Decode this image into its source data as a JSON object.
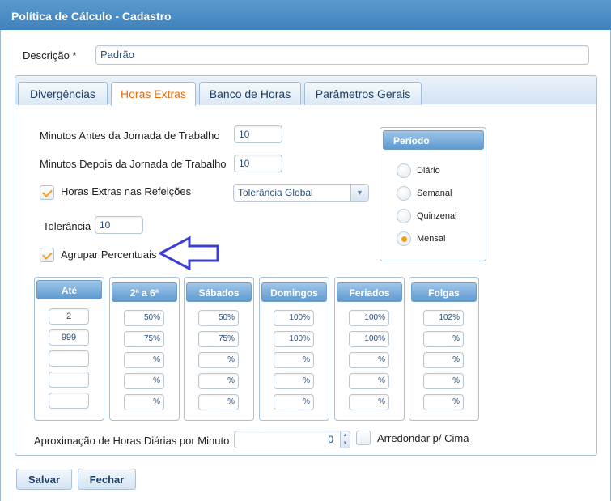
{
  "window": {
    "title": "Política de Cálculo - Cadastro"
  },
  "descricao": {
    "label": "Descrição *",
    "value": "Padrão"
  },
  "tabs": [
    {
      "label": "Divergências",
      "active": false
    },
    {
      "label": "Horas Extras",
      "active": true
    },
    {
      "label": "Banco de Horas",
      "active": false
    },
    {
      "label": "Parâmetros Gerais",
      "active": false
    }
  ],
  "form": {
    "minutos_antes": {
      "label": "Minutos Antes da Jornada de Trabalho",
      "value": "10"
    },
    "minutos_depois": {
      "label": "Minutos Depois da Jornada de Trabalho",
      "value": "10"
    },
    "horas_extras_refeicoes": {
      "label": "Horas Extras nas Refeições",
      "checked": true
    },
    "tolerancia_select": {
      "value": "Tolerância Global"
    },
    "tolerancia": {
      "label": "Tolerância",
      "value": "10"
    },
    "agrupar": {
      "label": "Agrupar Percentuais",
      "checked": true
    }
  },
  "periodo": {
    "title": "Período",
    "options": [
      {
        "label": "Diário",
        "selected": false
      },
      {
        "label": "Semanal",
        "selected": false
      },
      {
        "label": "Quinzenal",
        "selected": false
      },
      {
        "label": "Mensal",
        "selected": true
      }
    ]
  },
  "columns": [
    {
      "header": "Até",
      "values": [
        "2",
        "999",
        "",
        "",
        ""
      ]
    },
    {
      "header": "2ª a 6ª",
      "values": [
        "50%",
        "75%",
        "%",
        "%",
        "%"
      ]
    },
    {
      "header": "Sábados",
      "values": [
        "50%",
        "75%",
        "%",
        "%",
        "%"
      ]
    },
    {
      "header": "Domingos",
      "values": [
        "100%",
        "100%",
        "%",
        "%",
        "%"
      ]
    },
    {
      "header": "Feriados",
      "values": [
        "100%",
        "100%",
        "%",
        "%",
        "%"
      ]
    },
    {
      "header": "Folgas",
      "values": [
        "102%",
        "%",
        "%",
        "%",
        "%"
      ]
    }
  ],
  "aproximacao": {
    "label": "Aproximação de Horas Diárias por Minuto",
    "value": "0"
  },
  "arredondar": {
    "label": "Arredondar p/ Cima",
    "checked": false
  },
  "buttons": {
    "save": "Salvar",
    "close": "Fechar"
  },
  "colors": {
    "accent": "#e46e14",
    "titlebar": "#4a8cc5",
    "annotation_arrow": "#3d3fd1",
    "check": "#f0a31a"
  },
  "icons": {
    "annotation": "arrow-left-icon",
    "check": "check-icon",
    "dropdown": "chevron-down-icon",
    "spinner": "spinner-icon"
  }
}
